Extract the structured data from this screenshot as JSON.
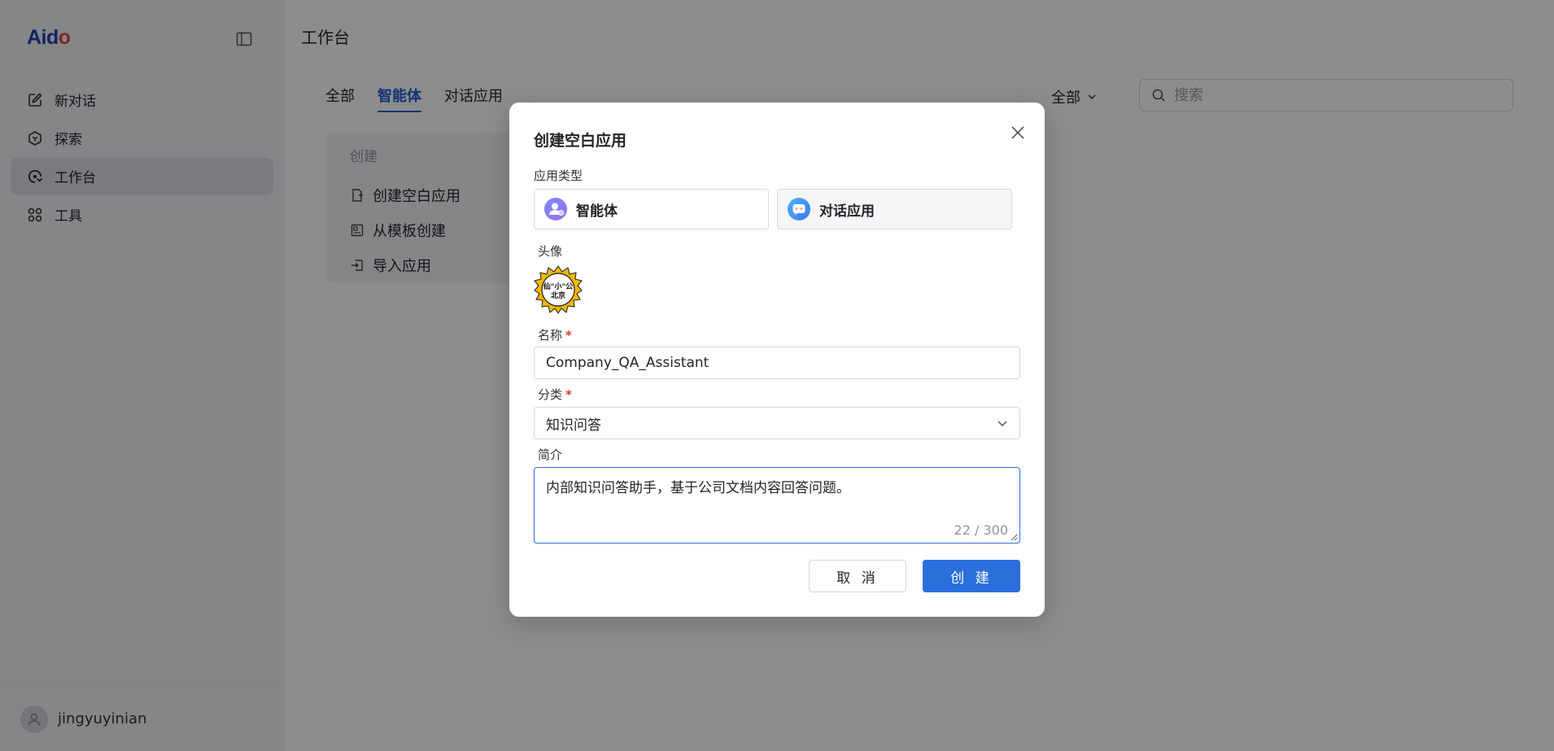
{
  "app": {
    "logo_prefix": "Aid",
    "logo_suffix": "o"
  },
  "sidebar": {
    "items": [
      {
        "label": "新对话",
        "icon": "edit-icon"
      },
      {
        "label": "探索",
        "icon": "cube-icon"
      },
      {
        "label": "工作台",
        "icon": "workbench-icon",
        "active": true
      },
      {
        "label": "工具",
        "icon": "grid-icon"
      }
    ],
    "user": {
      "name": "jingyuyinian"
    }
  },
  "main": {
    "title": "工作台",
    "tabs": [
      {
        "label": "全部"
      },
      {
        "label": "智能体",
        "active": true
      },
      {
        "label": "对话应用"
      }
    ],
    "filter": {
      "label": "全部"
    },
    "search": {
      "placeholder": "搜索"
    },
    "create_card": {
      "heading": "创建",
      "items": [
        {
          "label": "创建空白应用",
          "icon": "file-add-icon"
        },
        {
          "label": "从模板创建",
          "icon": "template-icon"
        },
        {
          "label": "导入应用",
          "icon": "import-icon"
        }
      ]
    }
  },
  "modal": {
    "title": "创建空白应用",
    "type_label": "应用类型",
    "types": [
      {
        "label": "智能体",
        "icon": "agent-icon"
      },
      {
        "label": "对话应用",
        "icon": "chat-app-icon"
      }
    ],
    "avatar_label": "头像",
    "avatar_text": [
      "仙\"小\"公",
      "北京"
    ],
    "name_label": "名称",
    "name_value": "Company_QA_Assistant",
    "category_label": "分类",
    "category_value": "知识问答",
    "intro_label": "简介",
    "intro_value": "内部知识问答助手，基于公司文档内容回答问题。",
    "counter": "22 / 300",
    "cancel_label": "取 消",
    "create_label": "创 建"
  },
  "colors": {
    "accent": "#2a6fdb",
    "required": "#d9363e"
  }
}
